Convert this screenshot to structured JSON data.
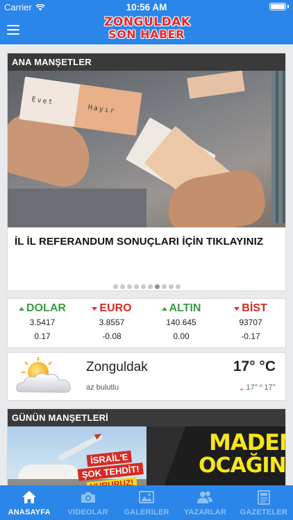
{
  "status_bar": {
    "carrier": "Carrier",
    "time": "10:56 AM",
    "battery_level": 1.0
  },
  "header": {
    "logo_line1": "ZONGULDAK",
    "logo_line2": "SON HABER",
    "menu_icon": "hamburger-icon",
    "brand_color": "#2a86e8"
  },
  "headlines": {
    "section_title": "ANA MANŞETLER",
    "ballot_label_1": "Evet",
    "ballot_label_2": "Hayır",
    "story_title": "İL İL REFERANDUM SONUÇLARI İÇİN TIKLAYINIZ",
    "carousel": {
      "count": 10,
      "active_index": 6
    }
  },
  "markets": [
    {
      "name": "DOLAR",
      "direction": "up",
      "value": "3.5417",
      "change": "0.17"
    },
    {
      "name": "EURO",
      "direction": "down",
      "value": "3.8557",
      "change": "-0.08"
    },
    {
      "name": "ALTIN",
      "direction": "up",
      "value": "140.645",
      "change": "0.00"
    },
    {
      "name": "BİST",
      "direction": "down",
      "value": "93707",
      "change": "-0.17"
    }
  ],
  "weather": {
    "icon": "partly-cloudy-icon",
    "city": "Zonguldak",
    "description": "az bulutlu",
    "temperature": "17° °C",
    "low": "17°",
    "high": "17°"
  },
  "daily": {
    "section_title": "GÜNÜN MANŞETLERİ",
    "paper1": {
      "line1": "İSRAİL'E",
      "line2": "ŞOK TEHDİT!",
      "line3": "VURURUZ!"
    },
    "paper2": {
      "line1": "MADEN",
      "line2": "OCAĞINDA"
    }
  },
  "tabs": [
    {
      "label": "ANASAYFA",
      "icon": "home-icon",
      "active": true
    },
    {
      "label": "VIDEOLAR",
      "icon": "camera-icon",
      "active": false
    },
    {
      "label": "GALERILER",
      "icon": "gallery-icon",
      "active": false
    },
    {
      "label": "YAZARLAR",
      "icon": "authors-icon",
      "active": false
    },
    {
      "label": "GAZETELER",
      "icon": "newspaper-icon",
      "active": false
    }
  ],
  "colors": {
    "up": "#3b9b3f",
    "down": "#d52a22",
    "tab_inactive": "#8fc0f4",
    "tab_active": "#ffffff"
  }
}
